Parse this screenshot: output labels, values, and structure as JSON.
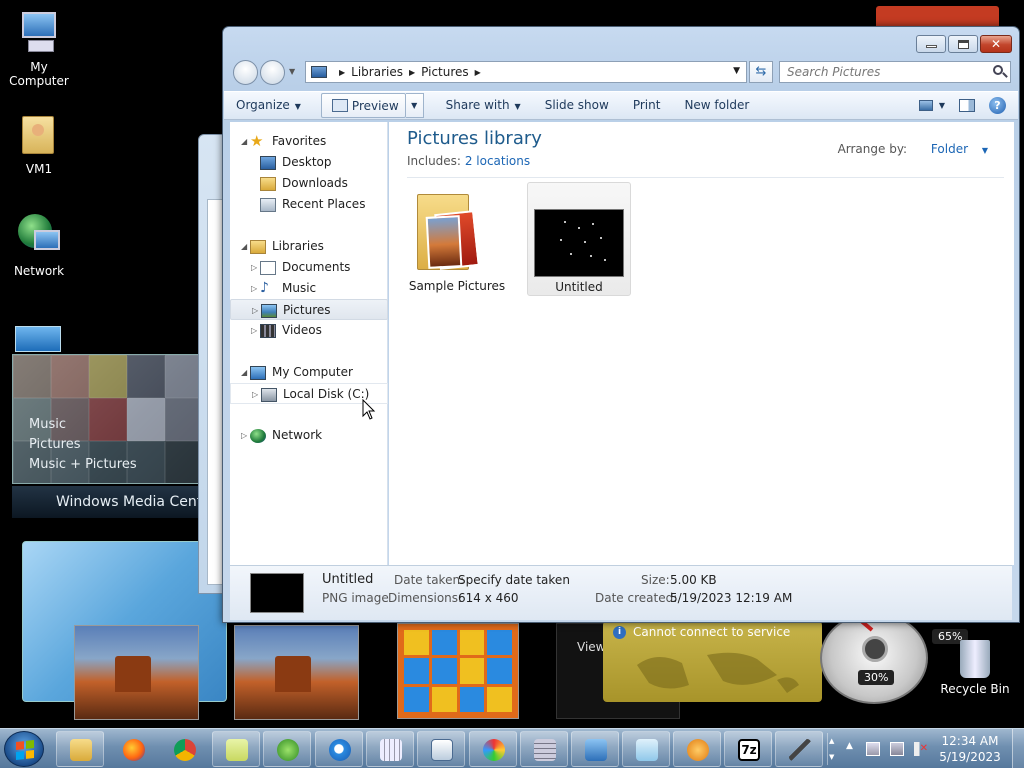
{
  "desktop": {
    "icons": [
      {
        "label": "My Computer"
      },
      {
        "label": "VM1"
      },
      {
        "label": "Network"
      },
      {
        "label": "Recycle Bin"
      }
    ],
    "media_center": {
      "menu": [
        "Music",
        "Pictures",
        "Music + Pictures"
      ],
      "brand": "Windows Media Center"
    },
    "weather_gadget": {
      "message": "Cannot connect to service"
    },
    "dark_card_text": "View",
    "meter": {
      "cpu_label": "30%",
      "mem_label": "65%",
      "cpu_pct": 30,
      "mem_pct": 65
    }
  },
  "explorer": {
    "address": {
      "segments": [
        "Libraries",
        "Pictures"
      ]
    },
    "search": {
      "placeholder": "Search Pictures"
    },
    "toolbar": {
      "organize": "Organize",
      "preview": "Preview",
      "share_with": "Share with",
      "slide_show": "Slide show",
      "print": "Print",
      "new_folder": "New folder"
    },
    "nav": {
      "favorites": "Favorites",
      "desktop": "Desktop",
      "downloads": "Downloads",
      "recent_places": "Recent Places",
      "libraries": "Libraries",
      "documents": "Documents",
      "music": "Music",
      "pictures": "Pictures",
      "videos": "Videos",
      "my_computer": "My Computer",
      "local_disk": "Local Disk (C:)",
      "network": "Network"
    },
    "library": {
      "title": "Pictures library",
      "includes_label": "Includes:",
      "includes_link": "2 locations",
      "arrange_label": "Arrange by:",
      "arrange_value": "Folder"
    },
    "items": [
      {
        "name": "Sample Pictures"
      },
      {
        "name": "Untitled"
      }
    ],
    "details": {
      "name": "Untitled",
      "type": "PNG image",
      "date_taken_label": "Date taken:",
      "date_taken_value": "Specify date taken",
      "dimensions_label": "Dimensions:",
      "dimensions_value": "614 x 460",
      "size_label": "Size:",
      "size_value": "5.00 KB",
      "date_created_label": "Date created:",
      "date_created_value": "5/19/2023 12:19 AM"
    }
  },
  "taskbar": {
    "clock_time": "12:34 AM",
    "clock_date": "5/19/2023",
    "sevenzip_label": "7z"
  },
  "colors": {
    "accent": "#1e5b8c",
    "link": "#1c66b5",
    "close_red": "#c2452b"
  }
}
